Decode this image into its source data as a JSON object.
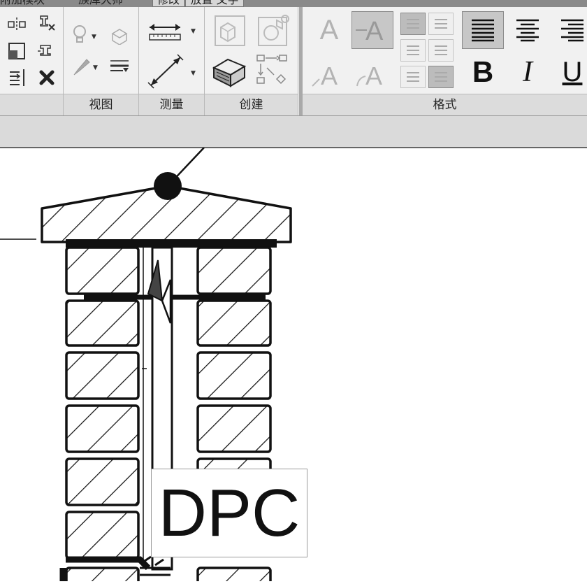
{
  "ribbon": {
    "tabs": [
      "附加模块",
      "族库大师",
      "修改 | 放置 文字"
    ],
    "panels": {
      "view": "视图",
      "measure": "测量",
      "create": "创建",
      "format": "格式"
    },
    "format_buttons": {
      "bold": "B",
      "italic": "I",
      "underline": "U"
    },
    "icons": {
      "modify": [
        "align-icon",
        "pin-icon",
        "scale-icon",
        "unpin-icon",
        "array-icon",
        "delete-icon"
      ],
      "view": [
        "lightbulb-icon",
        "render-icon",
        "paint-icon",
        "line-weight-icon"
      ],
      "measure": [
        "aligned-dimension-icon",
        "measure-between-icon"
      ],
      "create": [
        "create-part-icon",
        "create-group-icon",
        "create-assembly-icon",
        "create-similar-icon"
      ],
      "format": [
        "text-no-leader-icon",
        "text-straight-leader-icon",
        "text-angled-leader-icon",
        "text-arc-leader-icon",
        "align-left-icon",
        "align-center-icon",
        "align-right-icon"
      ]
    },
    "accent_pressed": "#c7c7c7"
  },
  "drawing": {
    "tag_text": "DPC"
  }
}
